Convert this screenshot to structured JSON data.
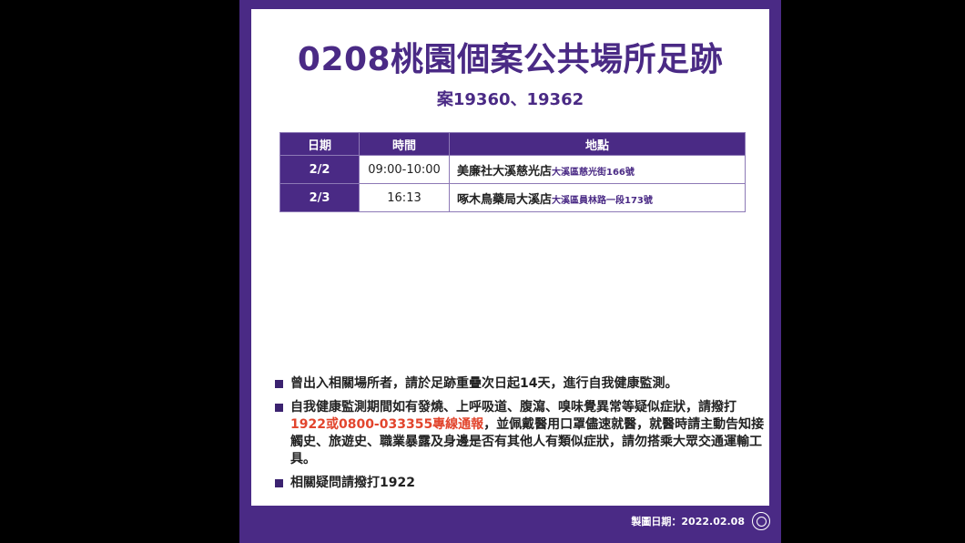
{
  "title": "0208桃園個案公共場所足跡",
  "subtitle": "案19360、19362",
  "table": {
    "headers": [
      "日期",
      "時間",
      "地點"
    ],
    "rows": [
      {
        "date": "2/2",
        "time": "09:00-10:00",
        "place": "美廉社大溪慈光店",
        "address": "大溪區慈光街166號"
      },
      {
        "date": "2/3",
        "time": "16:13",
        "place": "啄木鳥藥局大溪店",
        "address": "大溪區員林路一段173號"
      }
    ]
  },
  "notes": [
    {
      "text": "曾出入相關場所者，請於足跡重疊次日起14天，進行自我健康監測。"
    },
    {
      "before": "自我健康監測期間如有發燒、上呼吸道、腹瀉、嗅味覺異常等疑似症狀，請撥打",
      "highlight": "1922或0800-033355專線通報",
      "after": "，並佩戴醫用口罩儘速就醫，就醫時請主動告知接觸史、旅遊史、職業暴露及身邊是否有其他人有類似症狀，請勿搭乘大眾交通運輸工具。"
    },
    {
      "text": "相關疑問請撥打1922"
    }
  ],
  "footer": {
    "made_date": "製圖日期：2022.02.08",
    "seal_icon": "city-seal-icon"
  },
  "colors": {
    "primary": "#4a2a85",
    "highlight": "#e2452d",
    "background": "#000000"
  }
}
